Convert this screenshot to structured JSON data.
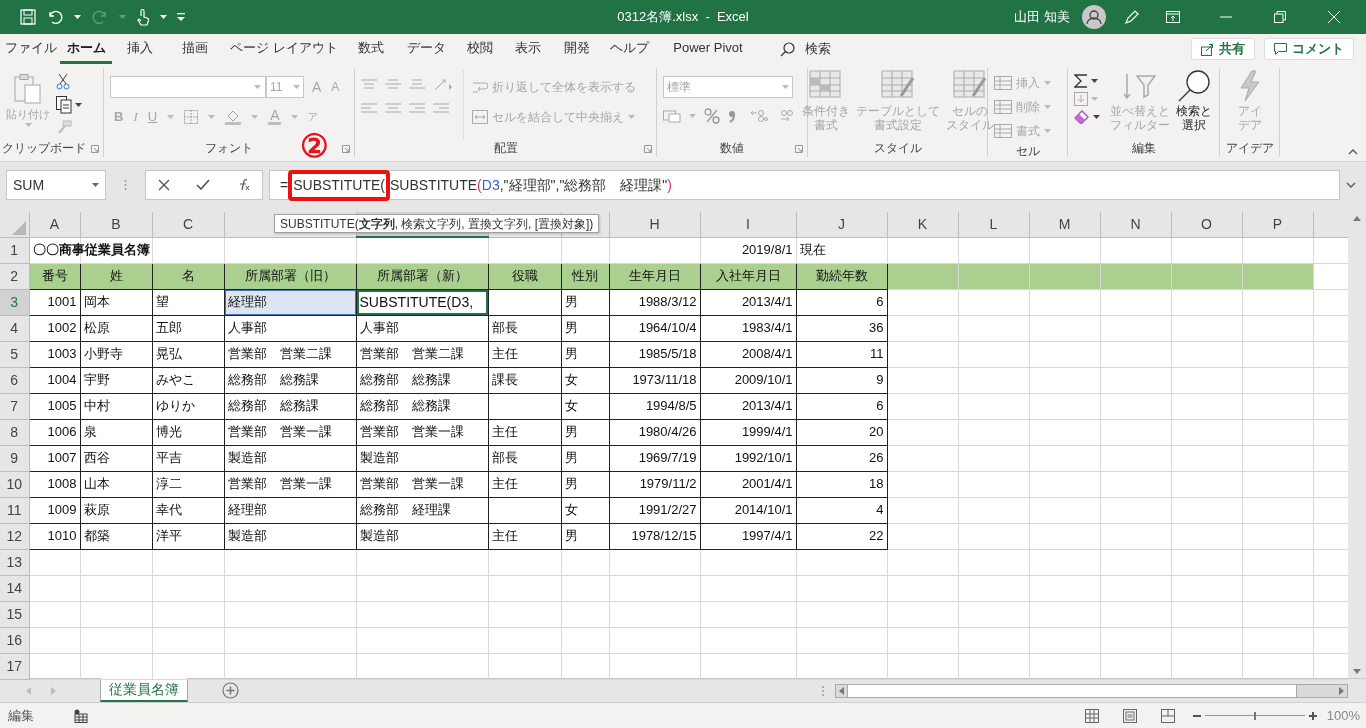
{
  "title_bar": {
    "title": "0312名簿.xlsx  -  Excel",
    "user": "山田 知美",
    "redo_disabled": true
  },
  "menu_tabs": [
    {
      "label": "ファイル",
      "selected": false
    },
    {
      "label": "ホーム",
      "selected": true
    },
    {
      "label": "挿入",
      "selected": false
    },
    {
      "label": "描画",
      "selected": false
    },
    {
      "label": "ページ レイアウト",
      "selected": false
    },
    {
      "label": "数式",
      "selected": false
    },
    {
      "label": "データ",
      "selected": false
    },
    {
      "label": "校閲",
      "selected": false
    },
    {
      "label": "表示",
      "selected": false
    },
    {
      "label": "開発",
      "selected": false
    },
    {
      "label": "ヘルプ",
      "selected": false
    },
    {
      "label": "Power Pivot",
      "selected": false
    }
  ],
  "search": {
    "label": "検索"
  },
  "share_buttons": [
    {
      "kind": "share",
      "label": "共有"
    },
    {
      "kind": "comment",
      "label": "コメント"
    }
  ],
  "ribbon": [
    {
      "kind": "clipboard",
      "label": "クリップボード",
      "paste": {
        "label": "貼り付け",
        "disabled": true
      }
    },
    {
      "kind": "font",
      "label": "フォント",
      "font_size": "11",
      "style_buttons": [
        "B",
        "I",
        "U"
      ],
      "grow": "A",
      "shrink": "A",
      "font_color": "A",
      "phonetic": "ア",
      "disabled": true
    },
    {
      "kind": "alignment",
      "label": "配置",
      "wrap": {
        "label": "折り返して全体を表示する",
        "disabled": true
      },
      "merge": {
        "label": "セルを結合して中央揃え",
        "disabled": true
      }
    },
    {
      "kind": "number",
      "label": "数値",
      "format": "標準",
      "disabled": true
    },
    {
      "kind": "styles",
      "label": "スタイル",
      "buttons": [
        {
          "lines": [
            "条件付き",
            "書式"
          ],
          "disabled": true
        },
        {
          "lines": [
            "テーブルとして",
            "書式設定"
          ],
          "disabled": true
        },
        {
          "lines": [
            "セルの",
            "スタイル"
          ],
          "disabled": true
        }
      ]
    },
    {
      "kind": "cells",
      "label": "セル",
      "buttons": [
        {
          "lines": [
            "挿入"
          ],
          "disabled": true
        },
        {
          "lines": [
            "削除"
          ],
          "disabled": true
        },
        {
          "lines": [
            "書式"
          ],
          "disabled": true
        }
      ]
    },
    {
      "kind": "editing",
      "label": "編集",
      "buttons": [
        {
          "lines": [
            "並べ替えと",
            "フィルター"
          ],
          "disabled": true
        },
        {
          "lines": [
            "検索と",
            "選択"
          ],
          "disabled": false
        }
      ]
    },
    {
      "kind": "ideas",
      "label": "アイデア",
      "buttons": [
        {
          "lines": [
            "アイ",
            "デア"
          ],
          "disabled": true
        }
      ]
    }
  ],
  "formula_bar": {
    "name_box": "SUM",
    "segments": [
      {
        "kind": "text",
        "text": "="
      },
      {
        "kind": "highlighted",
        "text": "SUBSTITUTE("
      },
      {
        "kind": "text",
        "text": "SUBSTITUTE"
      },
      {
        "kind": "paren",
        "text": "("
      },
      {
        "kind": "ref",
        "text": "D3"
      },
      {
        "kind": "text",
        "text": ",\"経理部\",\"総務部　経理課\""
      },
      {
        "kind": "paren",
        "text": ")"
      }
    ],
    "tooltip": "SUBSTITUTE(**文字列**, 検索文字列, 置換文字列, [置換対象])"
  },
  "annotation": {
    "text": "②"
  },
  "sheet": {
    "columns": [
      {
        "letter": "A",
        "selected": false
      },
      {
        "letter": "B",
        "selected": false
      },
      {
        "letter": "C",
        "selected": false
      },
      {
        "selected": false
      },
      {
        "selected": true
      },
      {
        "selected": false
      },
      {
        "selected": false
      },
      {
        "letter": "H",
        "selected": false
      },
      {
        "letter": "I",
        "selected": false
      },
      {
        "letter": "J",
        "selected": false
      },
      {
        "letter": "K",
        "selected": false
      },
      {
        "letter": "L",
        "selected": false
      },
      {
        "letter": "M",
        "selected": false
      },
      {
        "letter": "N",
        "selected": false
      },
      {
        "letter": "O",
        "selected": false
      },
      {
        "letter": "P",
        "selected": false
      }
    ],
    "rows": [
      {
        "number": "1",
        "kind": "title",
        "selected": false,
        "cells": [
          {
            "text": "〇〇商事従業員名簿"
          },
          null,
          null,
          null,
          null,
          null,
          null,
          null,
          {
            "text": "2019/8/1"
          },
          {
            "text": "現在"
          }
        ]
      },
      {
        "number": "2",
        "kind": "header",
        "selected": false,
        "cells": [
          {
            "text": "番号"
          },
          {
            "text": "姓"
          },
          {
            "text": "名"
          },
          {
            "text": "所属部署（旧）"
          },
          {
            "text": "所属部署（新）"
          },
          {
            "text": "役職"
          },
          {
            "text": "性別"
          },
          {
            "text": "生年月日"
          },
          {
            "text": "入社年月日"
          },
          {
            "text": "勤続年数"
          }
        ]
      },
      {
        "number": "3",
        "kind": "data",
        "selected": true,
        "cells": [
          {
            "text": "1001"
          },
          {
            "text": "岡本"
          },
          {
            "text": "望"
          },
          {
            "text": "経理部",
            "referenced": true
          },
          {
            "text": "SUBSTITUTE(D3,",
            "editing": true
          },
          null,
          {
            "text": "男"
          },
          {
            "text": "1988/3/12"
          },
          {
            "text": "2013/4/1"
          },
          {
            "text": "6"
          }
        ]
      },
      {
        "number": "4",
        "kind": "data",
        "selected": false,
        "cells": [
          {
            "text": "1002"
          },
          {
            "text": "松原"
          },
          {
            "text": "五郎"
          },
          {
            "text": "人事部"
          },
          {
            "text": "人事部"
          },
          {
            "text": "部長"
          },
          {
            "text": "男"
          },
          {
            "text": "1964/10/4"
          },
          {
            "text": "1983/4/1"
          },
          {
            "text": "36"
          }
        ]
      },
      {
        "number": "5",
        "kind": "data",
        "selected": false,
        "cells": [
          {
            "text": "1003"
          },
          {
            "text": "小野寺"
          },
          {
            "text": "晃弘"
          },
          {
            "text": "営業部　営業二課"
          },
          {
            "text": "営業部　営業二課"
          },
          {
            "text": "主任"
          },
          {
            "text": "男"
          },
          {
            "text": "1985/5/18"
          },
          {
            "text": "2008/4/1"
          },
          {
            "text": "11"
          }
        ]
      },
      {
        "number": "6",
        "kind": "data",
        "selected": false,
        "cells": [
          {
            "text": "1004"
          },
          {
            "text": "宇野"
          },
          {
            "text": "みやこ"
          },
          {
            "text": "総務部　総務課"
          },
          {
            "text": "総務部　総務課"
          },
          {
            "text": "課長"
          },
          {
            "text": "女"
          },
          {
            "text": "1973/11/18"
          },
          {
            "text": "2009/10/1"
          },
          {
            "text": "9"
          }
        ]
      },
      {
        "number": "7",
        "kind": "data",
        "selected": false,
        "cells": [
          {
            "text": "1005"
          },
          {
            "text": "中村"
          },
          {
            "text": "ゆりか"
          },
          {
            "text": "総務部　総務課"
          },
          {
            "text": "総務部　総務課"
          },
          null,
          {
            "text": "女"
          },
          {
            "text": "1994/8/5"
          },
          {
            "text": "2013/4/1"
          },
          {
            "text": "6"
          }
        ]
      },
      {
        "number": "8",
        "kind": "data",
        "selected": false,
        "cells": [
          {
            "text": "1006"
          },
          {
            "text": "泉"
          },
          {
            "text": "博光"
          },
          {
            "text": "営業部　営業一課"
          },
          {
            "text": "営業部　営業一課"
          },
          {
            "text": "主任"
          },
          {
            "text": "男"
          },
          {
            "text": "1980/4/26"
          },
          {
            "text": "1999/4/1"
          },
          {
            "text": "20"
          }
        ]
      },
      {
        "number": "9",
        "kind": "data",
        "selected": false,
        "cells": [
          {
            "text": "1007"
          },
          {
            "text": "西谷"
          },
          {
            "text": "平吉"
          },
          {
            "text": "製造部"
          },
          {
            "text": "製造部"
          },
          {
            "text": "部長"
          },
          {
            "text": "男"
          },
          {
            "text": "1969/7/19"
          },
          {
            "text": "1992/10/1"
          },
          {
            "text": "26"
          }
        ]
      },
      {
        "number": "10",
        "kind": "data",
        "selected": false,
        "cells": [
          {
            "text": "1008"
          },
          {
            "text": "山本"
          },
          {
            "text": "淳二"
          },
          {
            "text": "営業部　営業一課"
          },
          {
            "text": "営業部　営業一課"
          },
          {
            "text": "主任"
          },
          {
            "text": "男"
          },
          {
            "text": "1979/11/2"
          },
          {
            "text": "2001/4/1"
          },
          {
            "text": "18"
          }
        ]
      },
      {
        "number": "11",
        "kind": "data",
        "selected": false,
        "cells": [
          {
            "text": "1009"
          },
          {
            "text": "萩原"
          },
          {
            "text": "幸代"
          },
          {
            "text": "経理部"
          },
          {
            "text": "総務部　経理課"
          },
          null,
          {
            "text": "女"
          },
          {
            "text": "1991/2/27"
          },
          {
            "text": "2014/10/1"
          },
          {
            "text": "4"
          }
        ]
      },
      {
        "number": "12",
        "kind": "data",
        "selected": false,
        "cells": [
          {
            "text": "1010"
          },
          {
            "text": "都築"
          },
          {
            "text": "洋平"
          },
          {
            "text": "製造部"
          },
          {
            "text": "製造部"
          },
          {
            "text": "主任"
          },
          {
            "text": "男"
          },
          {
            "text": "1978/12/15"
          },
          {
            "text": "1997/4/1"
          },
          {
            "text": "22"
          }
        ]
      },
      {
        "number": "13",
        "kind": "empty",
        "selected": false
      },
      {
        "number": "14",
        "kind": "empty",
        "selected": false
      },
      {
        "number": "15",
        "kind": "empty",
        "selected": false
      },
      {
        "number": "16",
        "kind": "empty",
        "selected": false
      },
      {
        "number": "17",
        "kind": "empty",
        "selected": false
      }
    ]
  },
  "sheet_tabs": [
    {
      "label": "従業員名簿",
      "selected": true
    }
  ],
  "status_bar": {
    "mode": "編集",
    "zoom": "100%",
    "zoom_slider": {
      "level": 0.5
    }
  }
}
